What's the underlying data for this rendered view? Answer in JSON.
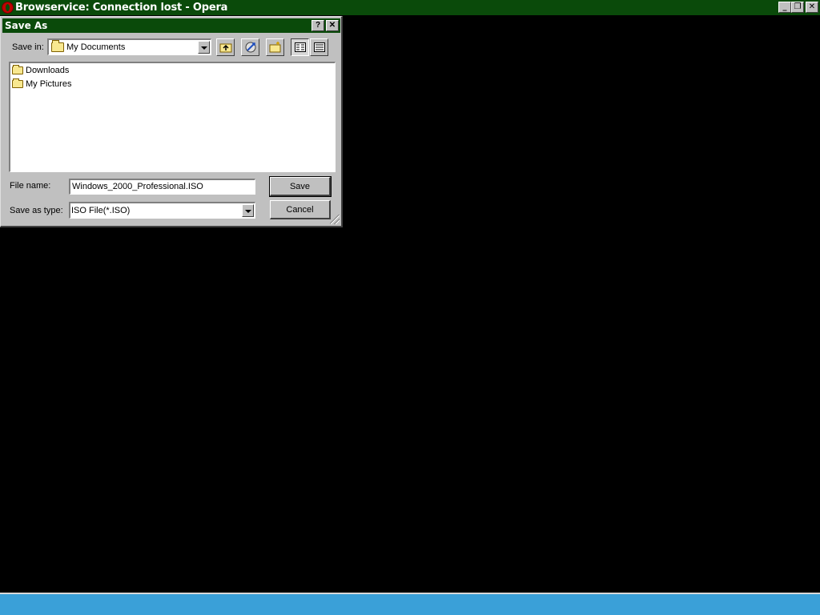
{
  "app": {
    "title": "Browservice: Connection lost - Opera",
    "minimize": "_",
    "restore": "❐",
    "close": "✕"
  },
  "dialog": {
    "title": "Save As",
    "help": "?",
    "close": "✕",
    "save_in_label": "Save in:",
    "save_in_value": "My Documents",
    "files": [
      {
        "name": "Downloads",
        "icon": "folder-icon"
      },
      {
        "name": "My Pictures",
        "icon": "folder-icon"
      }
    ],
    "file_name_label": "File name:",
    "file_name_value": "Windows_2000_Professional.ISO",
    "save_type_label": "Save as type:",
    "save_type_value": "ISO File(*.ISO)",
    "save_button": "Save",
    "cancel_button": "Cancel"
  },
  "colors": {
    "titlebar": "#0a4a0a",
    "desktop": "#000000",
    "dialog_face": "#c0c0c0",
    "taskbar": "#3aa0d8"
  }
}
